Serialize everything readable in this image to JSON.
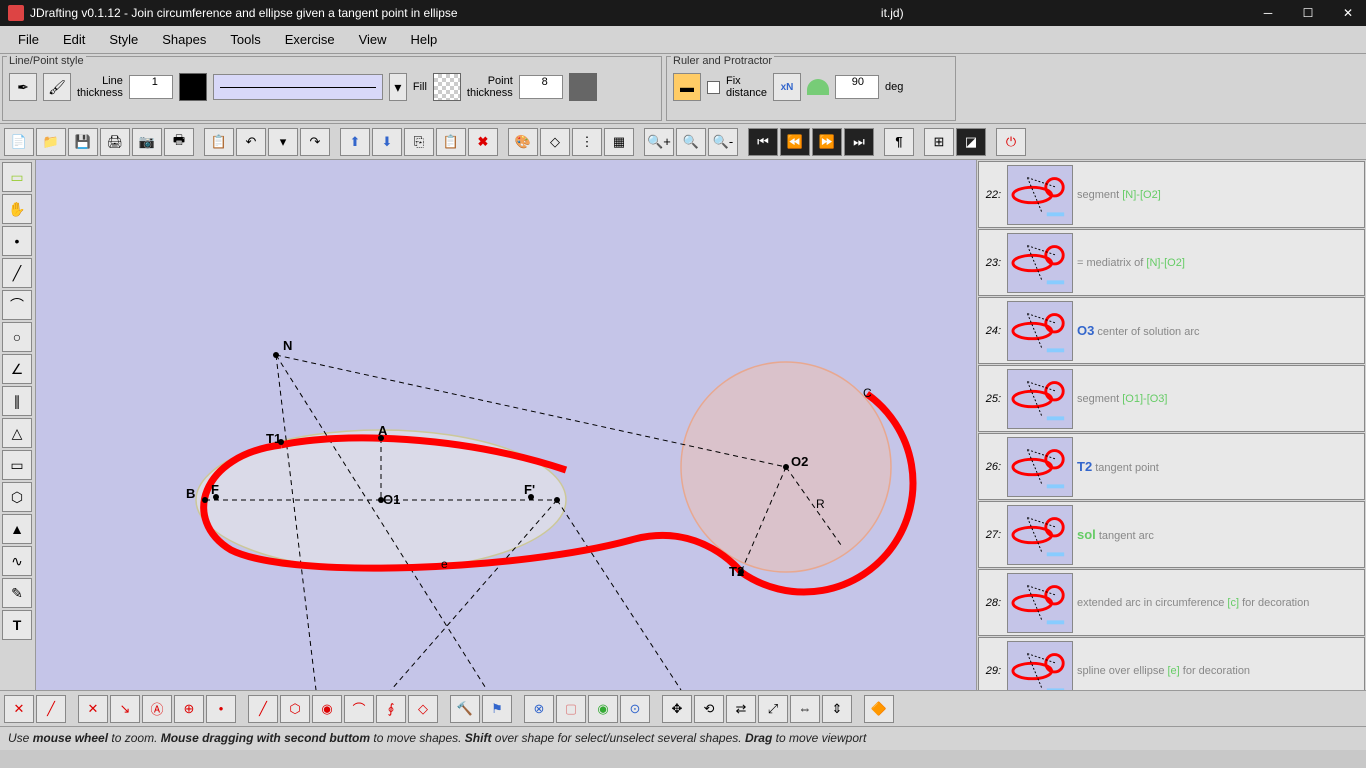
{
  "title": "JDrafting   v0.1.12 - Join circumference and ellipse  given a tangent point in ellipse",
  "title_suffix": "it.jd)",
  "menu": [
    "File",
    "Edit",
    "Style",
    "Shapes",
    "Tools",
    "Exercise",
    "View",
    "Help"
  ],
  "panel_linepoint": {
    "title": "Line/Point style",
    "line_thickness_label": "Line thickness",
    "line_thickness_value": "1",
    "fill_label": "Fill",
    "point_thickness_label": "Point thickness",
    "point_thickness_value": "8"
  },
  "panel_ruler": {
    "title": "Ruler and Protractor",
    "fix_label": "Fix distance",
    "xn_label": "xN",
    "angle_value": "90",
    "deg_label": "deg"
  },
  "canvas_labels": {
    "N": "N",
    "T1": "T1",
    "A": "A",
    "B": "B",
    "F": "F",
    "F2": "F'",
    "O1": "O1",
    "O2": "O2",
    "R": "R",
    "T2": "T2",
    "C": "C",
    "e": "e"
  },
  "history": [
    {
      "num": "22:",
      "text": "segment",
      "extra": "[N]-[O2]"
    },
    {
      "num": "23:",
      "text": "= mediatrix of",
      "extra": "[N]-[O2]"
    },
    {
      "num": "24:",
      "key": "O3",
      "keyclass": "blue",
      "text": "center of solution arc"
    },
    {
      "num": "25:",
      "text": "segment",
      "extra": "[O1]-[O3]"
    },
    {
      "num": "26:",
      "key": "T2",
      "keyclass": "blue",
      "text": "tangent point"
    },
    {
      "num": "27:",
      "key": "sol",
      "keyclass": "green",
      "text": "tangent arc"
    },
    {
      "num": "28:",
      "text": "extended arc in circumference",
      "extra": "[c]",
      "text2": "for decoration"
    },
    {
      "num": "29:",
      "text": "spline over ellipse",
      "extra": "[e]",
      "text2": "for decoration"
    }
  ],
  "status": "Use <b>mouse wheel</b> to zoom. <b>Mouse dragging with second buttom</b> to move shapes. <b>Shift</b> over shape for select/unselect several shapes. <b>Drag</b> to move viewport"
}
